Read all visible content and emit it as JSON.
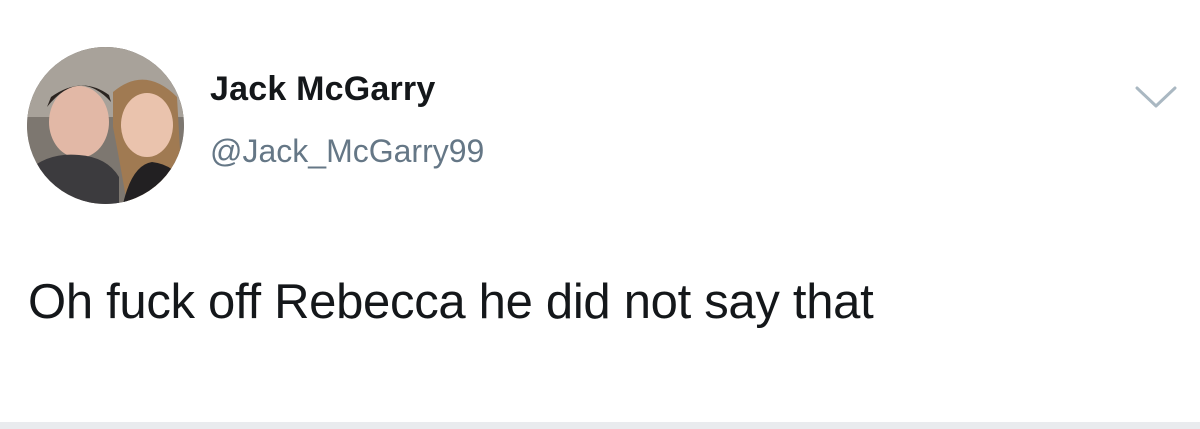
{
  "tweet": {
    "author": {
      "display_name": "Jack McGarry",
      "handle": "@Jack_McGarry99",
      "avatar_icon": "profile-photo"
    },
    "text": "Oh fuck off Rebecca he did not say that",
    "menu_icon": "chevron-down-icon"
  },
  "colors": {
    "background": "#ffffff",
    "name": "#14171a",
    "handle": "#657786",
    "chevron": "#aab8c2"
  }
}
